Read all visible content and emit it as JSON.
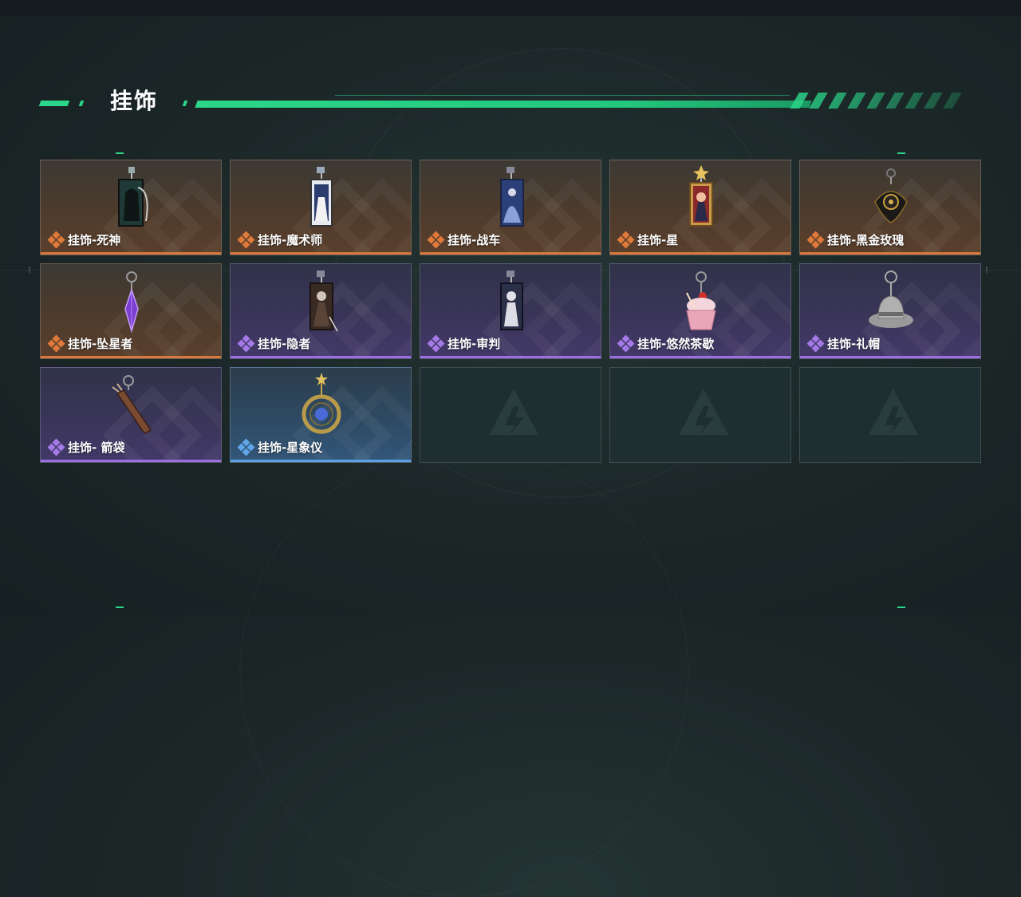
{
  "header": {
    "title": "挂饰"
  },
  "items": [
    {
      "label": "挂饰-死神",
      "rarity": "orange",
      "icon": "reaper-card-icon"
    },
    {
      "label": "挂饰-魔术师",
      "rarity": "orange",
      "icon": "magician-card-icon"
    },
    {
      "label": "挂饰-战车",
      "rarity": "orange",
      "icon": "chariot-card-icon"
    },
    {
      "label": "挂饰-星",
      "rarity": "orange",
      "icon": "star-card-icon"
    },
    {
      "label": "挂饰-黑金玫瑰",
      "rarity": "orange",
      "icon": "black-gold-rose-icon"
    },
    {
      "label": "挂饰-坠星者",
      "rarity": "orange",
      "icon": "purple-crystal-icon"
    },
    {
      "label": "挂饰-隐者",
      "rarity": "purple",
      "icon": "hermit-card-icon"
    },
    {
      "label": "挂饰-审判",
      "rarity": "purple",
      "icon": "judgement-card-icon"
    },
    {
      "label": "挂饰-悠然茶歇",
      "rarity": "purple",
      "icon": "cupcake-icon"
    },
    {
      "label": "挂饰-礼帽",
      "rarity": "purple",
      "icon": "fedora-hat-icon"
    },
    {
      "label": "挂饰- 箭袋",
      "rarity": "purple",
      "icon": "quiver-icon"
    },
    {
      "label": "挂饰-星象仪",
      "rarity": "blue",
      "icon": "astrolabe-icon"
    }
  ],
  "empty_slots": 3,
  "colors": {
    "accent": "#2bd68a",
    "orange": "#d9793c",
    "purple": "#9a6fe0",
    "blue": "#5aa3e6"
  }
}
